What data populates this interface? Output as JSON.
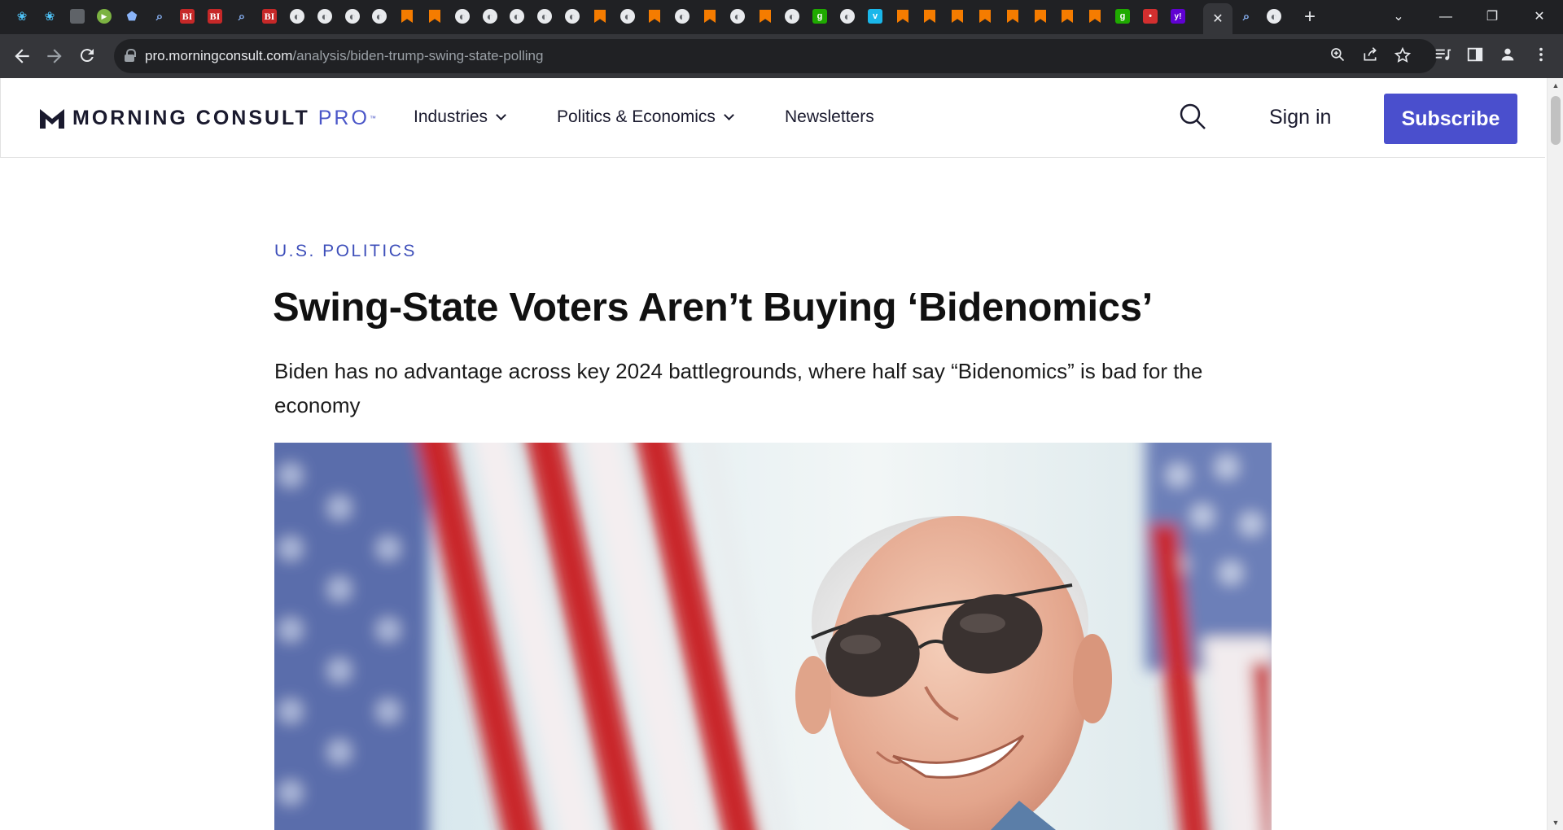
{
  "browser": {
    "tabs": [
      {
        "icon": "guardian-icon",
        "kind": "guardian",
        "glyph": ""
      },
      {
        "icon": "guardian-icon",
        "kind": "guardian",
        "glyph": ""
      },
      {
        "icon": "flag-icon",
        "kind": "flag",
        "glyph": ""
      },
      {
        "icon": "play-icon",
        "kind": "play",
        "glyph": ""
      },
      {
        "icon": "cap-icon",
        "kind": "cap",
        "glyph": ""
      },
      {
        "icon": "search-icon",
        "kind": "search",
        "glyph": ""
      },
      {
        "icon": "business-insider-icon",
        "kind": "bi",
        "glyph": "BI"
      },
      {
        "icon": "business-insider-icon",
        "kind": "bi",
        "glyph": "BI"
      },
      {
        "icon": "search-icon",
        "kind": "search",
        "glyph": ""
      },
      {
        "icon": "business-insider-icon",
        "kind": "bi",
        "glyph": "BI"
      },
      {
        "icon": "globe-icon",
        "kind": "globe",
        "glyph": ""
      },
      {
        "icon": "globe-icon",
        "kind": "globe",
        "glyph": ""
      },
      {
        "icon": "globe-icon",
        "kind": "globe",
        "glyph": ""
      },
      {
        "icon": "globe-icon",
        "kind": "globe",
        "glyph": ""
      },
      {
        "icon": "bookmark-icon",
        "kind": "bookmark",
        "glyph": ""
      },
      {
        "icon": "bookmark-icon",
        "kind": "bookmark",
        "glyph": ""
      },
      {
        "icon": "globe-icon",
        "kind": "globe",
        "glyph": ""
      },
      {
        "icon": "globe-icon",
        "kind": "globe",
        "glyph": ""
      },
      {
        "icon": "globe-icon",
        "kind": "globe",
        "glyph": ""
      },
      {
        "icon": "globe-icon",
        "kind": "globe",
        "glyph": ""
      },
      {
        "icon": "globe-icon",
        "kind": "globe",
        "glyph": ""
      },
      {
        "icon": "bookmark-icon",
        "kind": "bookmark",
        "glyph": ""
      },
      {
        "icon": "globe-icon",
        "kind": "globe",
        "glyph": ""
      },
      {
        "icon": "bookmark-icon",
        "kind": "bookmark",
        "glyph": ""
      },
      {
        "icon": "globe-icon",
        "kind": "globe",
        "glyph": ""
      },
      {
        "icon": "bookmark-icon",
        "kind": "bookmark",
        "glyph": ""
      },
      {
        "icon": "globe-icon",
        "kind": "globe",
        "glyph": ""
      },
      {
        "icon": "bookmark-icon",
        "kind": "bookmark",
        "glyph": ""
      },
      {
        "icon": "globe-icon",
        "kind": "globe",
        "glyph": ""
      },
      {
        "icon": "goodreads-icon",
        "kind": "gr",
        "glyph": "g"
      },
      {
        "icon": "globe-icon",
        "kind": "globe",
        "glyph": ""
      },
      {
        "icon": "vimeo-icon",
        "kind": "vim",
        "glyph": "v"
      },
      {
        "icon": "bookmark-icon",
        "kind": "bookmark",
        "glyph": ""
      },
      {
        "icon": "bookmark-icon",
        "kind": "bookmark",
        "glyph": ""
      },
      {
        "icon": "bookmark-icon",
        "kind": "bookmark",
        "glyph": ""
      },
      {
        "icon": "bookmark-icon",
        "kind": "bookmark",
        "glyph": ""
      },
      {
        "icon": "bookmark-icon",
        "kind": "bookmark",
        "glyph": ""
      },
      {
        "icon": "bookmark-icon",
        "kind": "bookmark",
        "glyph": ""
      },
      {
        "icon": "bookmark-icon",
        "kind": "bookmark",
        "glyph": ""
      },
      {
        "icon": "bookmark-icon",
        "kind": "bookmark",
        "glyph": ""
      },
      {
        "icon": "goodreads-icon",
        "kind": "gr",
        "glyph": "g"
      },
      {
        "icon": "podcast-icon",
        "kind": "mic",
        "glyph": "•"
      },
      {
        "icon": "yahoo-icon",
        "kind": "yh",
        "glyph": "y!"
      }
    ],
    "active_tab_close": "✕",
    "after_tabs": [
      {
        "icon": "search-icon",
        "kind": "search",
        "glyph": ""
      },
      {
        "icon": "globe-icon",
        "kind": "globe",
        "glyph": ""
      }
    ],
    "new_tab": "+",
    "window": {
      "tab_search": "⌄",
      "minimize": "—",
      "restore": "❐",
      "close": "✕"
    },
    "url_host": "pro.morningconsult.com",
    "url_path": "/analysis/biden-trump-swing-state-polling"
  },
  "site": {
    "logo_text": "MORNING CONSULT",
    "logo_pro": "PRO",
    "logo_tm": "™",
    "nav": {
      "industries": "Industries",
      "politics": "Politics & Economics",
      "newsletters": "Newsletters"
    },
    "sign_in": "Sign in",
    "subscribe": "Subscribe",
    "brand_color": "#4a4fcd"
  },
  "article": {
    "kicker": "U.S. POLITICS",
    "headline": "Swing-State Voters Aren’t Buying ‘Bidenomics’",
    "dek": "Biden has no advantage across key 2024 battlegrounds, where half say “Bidenomics” is bad for the economy"
  }
}
